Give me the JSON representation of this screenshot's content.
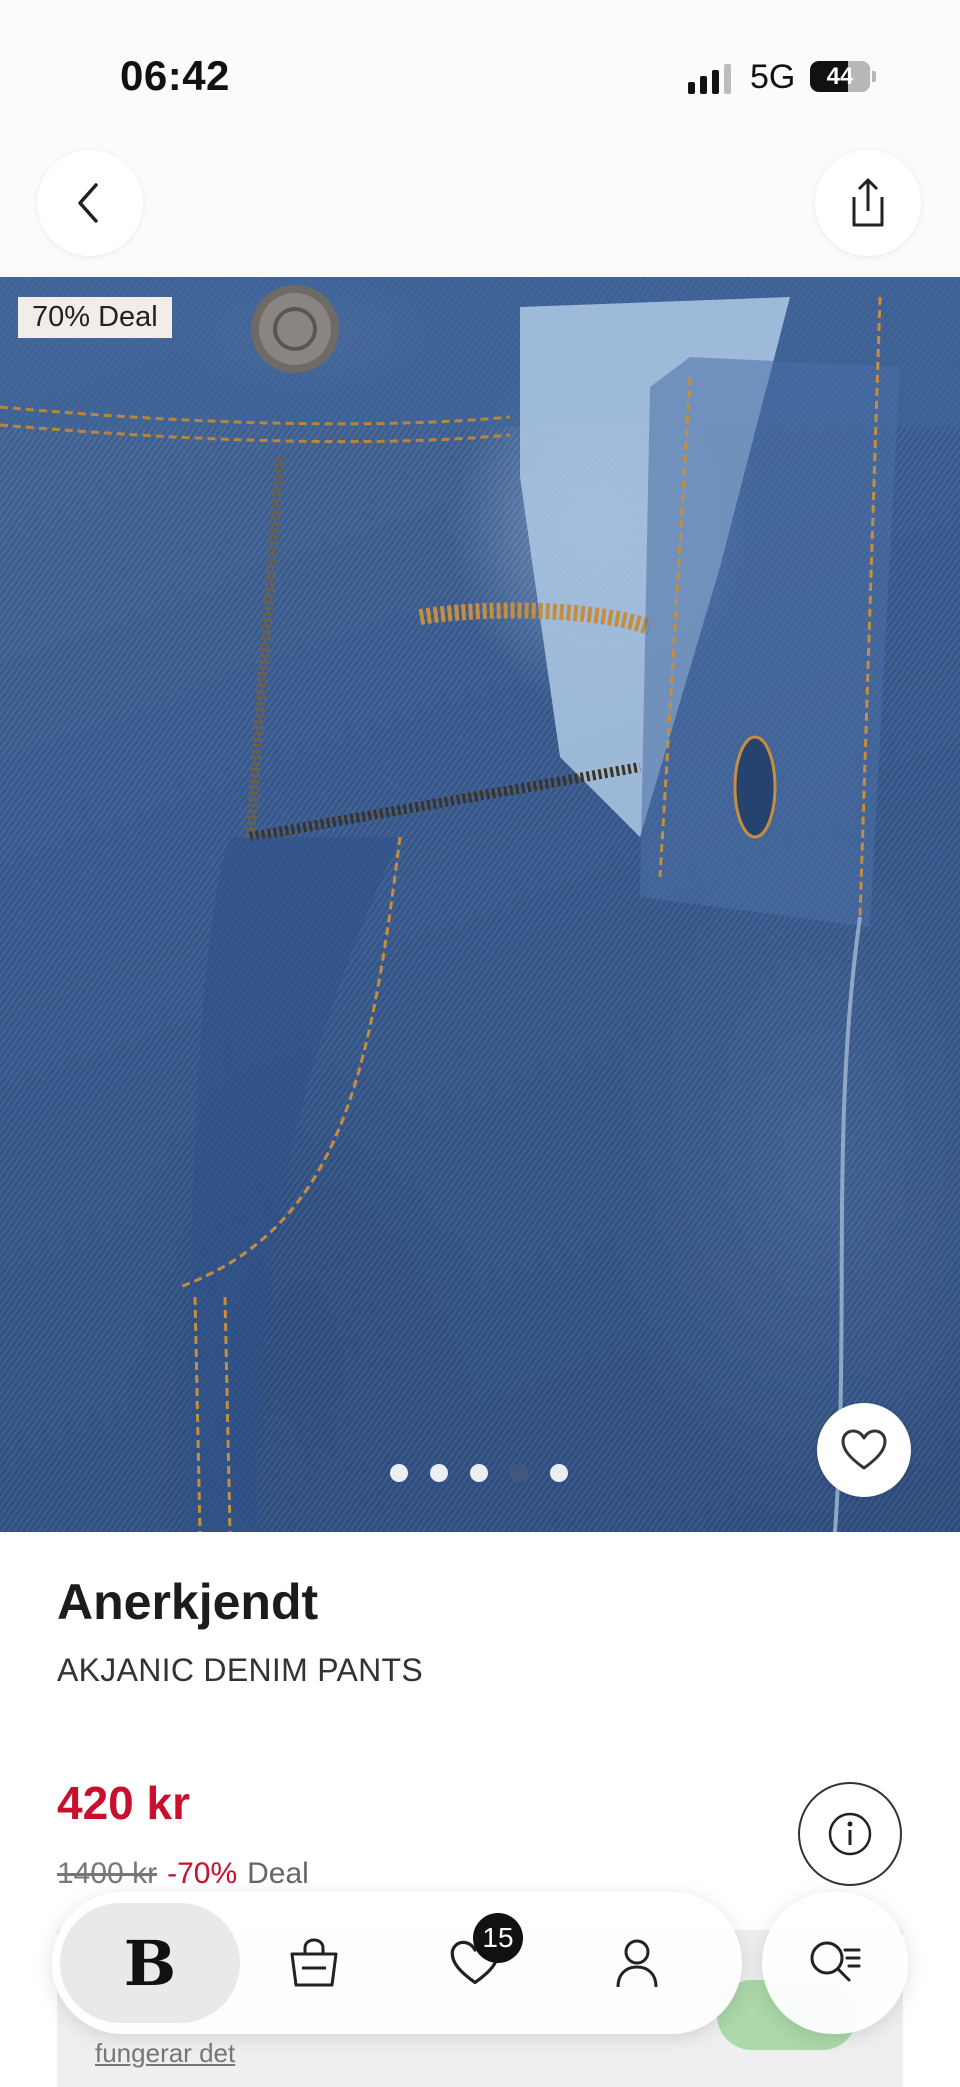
{
  "status_bar": {
    "time": "06:42",
    "network": "5G",
    "battery": "44"
  },
  "header": {
    "back_icon": "chevron-left-icon",
    "share_icon": "share-icon"
  },
  "hero": {
    "deal_tag": "70% Deal",
    "image_count": 5,
    "active_image_index": 3,
    "favorite_icon": "heart-icon"
  },
  "product": {
    "brand": "Anerkjendt",
    "name": "AKJANIC DENIM PANTS",
    "price": "420 kr",
    "original_price": "1400 kr",
    "discount": "-70%",
    "deal_label": "Deal",
    "info_icon": "info-icon"
  },
  "banner": {
    "link_text": "fungerar det"
  },
  "nav": {
    "items": [
      {
        "name": "home",
        "icon": "logo-b",
        "label": "B"
      },
      {
        "name": "bag",
        "icon": "shopping-bag-icon"
      },
      {
        "name": "favorites",
        "icon": "heart-icon",
        "badge": "15"
      },
      {
        "name": "profile",
        "icon": "user-icon"
      }
    ],
    "search_icon": "search-filter-icon"
  },
  "colors": {
    "price_red": "#c8102e",
    "background": "#ffffff",
    "denim": "#3b5d92"
  }
}
